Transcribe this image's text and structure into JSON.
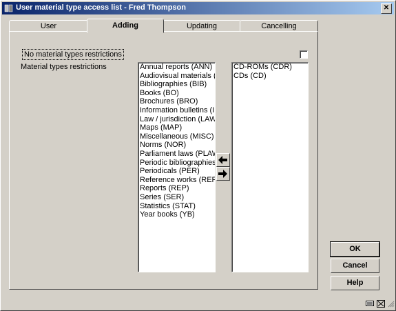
{
  "window": {
    "title": "User material type access list - Fred Thompson",
    "close_label": "✕"
  },
  "tabs": [
    {
      "label": "User"
    },
    {
      "label": "Adding"
    },
    {
      "label": "Updating"
    },
    {
      "label": "Cancelling"
    }
  ],
  "form": {
    "no_restrictions_label": "No material types restrictions",
    "restrictions_label": "Material types restrictions"
  },
  "available_types": [
    "Annual reports (ANN)",
    "Audiovisual materials (A",
    "Bibliographies (BIB)",
    "Books (BO)",
    "Brochures (BRO)",
    "Information bulletins (IN",
    "Law / jurisdiction (LAW)",
    "Maps (MAP)",
    "Miscellaneous (MISC)",
    "Norms (NOR)",
    "Parliament laws (PLAW",
    "Periodic bibliographies",
    "Periodicals (PER)",
    "Reference works (REF)",
    "Reports (REP)",
    "Series (SER)",
    "Statistics (STAT)",
    "Year books (YB)"
  ],
  "selected_types": [
    "CD-ROMs (CDR)",
    "CDs (CD)"
  ],
  "arrows": {
    "left": "🡐",
    "right": "🡒"
  },
  "buttons": {
    "ok": "OK",
    "cancel": "Cancel",
    "help": "Help"
  }
}
